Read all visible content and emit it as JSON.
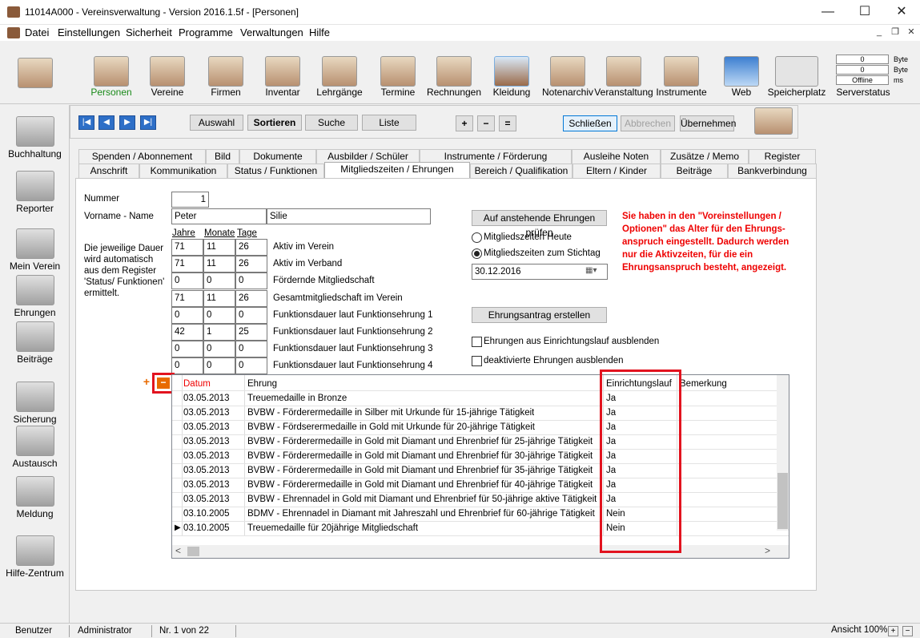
{
  "window": {
    "title": "11014A000 - Vereinsverwaltung - Version 2016.1.5f - [Personen]"
  },
  "menu": [
    "Datei",
    "Einstellungen",
    "Sicherheit",
    "Programme",
    "Verwaltungen",
    "Hilfe"
  ],
  "toolbar": {
    "items": [
      "Personen",
      "Vereine",
      "Firmen",
      "Inventar",
      "Lehrgänge",
      "Termine",
      "Rechnungen",
      "Kleidung",
      "Notenarchiv",
      "Veranstaltung",
      "Instrumente",
      "Web",
      "Speicherplatz"
    ],
    "server": {
      "v1": "0",
      "u1": "Byte",
      "v2": "0",
      "u2": "Byte",
      "v3": "Offline",
      "u3": "ms",
      "label": "Serverstatus"
    }
  },
  "sidebar": [
    "Buchhaltung",
    "Reporter",
    "Mein Verein",
    "Ehrungen",
    "Beiträge",
    "Sicherung",
    "Austausch",
    "Meldung",
    "Hilfe-Zentrum"
  ],
  "nav": {
    "auswahl": "Auswahl",
    "sortieren": "Sortieren",
    "suche": "Suche",
    "liste": "Liste",
    "plus": "+",
    "minus": "−",
    "eq": "=",
    "schliessen": "Schließen",
    "abbrechen": "Abbrechen",
    "uebernehmen": "Übernehmen"
  },
  "tabs_row1": [
    "Spenden / Abonnement",
    "Bild",
    "Dokumente",
    "Ausbilder / Schüler",
    "Instrumente / Förderung",
    "Ausleihe Noten",
    "Zusätze / Memo",
    "Register"
  ],
  "tabs_row2": [
    "Anschrift",
    "Kommunikation",
    "Status / Funktionen",
    "Mitgliedszeiten / Ehrungen",
    "Bereich / Qualifikation",
    "Eltern / Kinder",
    "Beiträge",
    "Bankverbindung"
  ],
  "form": {
    "nummer_label": "Nummer",
    "nummer": "1",
    "name_label": "Vorname - Name",
    "vorname": "Peter",
    "nachname": "Silie",
    "info": "Die jeweilige Dauer wird automatisch aus dem Register 'Status/ Funktionen' ermittelt.",
    "col_jahre": "Jahre",
    "col_monate": "Monate",
    "col_tage": "Tage",
    "rows": [
      {
        "j": "71",
        "m": "11",
        "t": "26",
        "label": "Aktiv im Verein"
      },
      {
        "j": "71",
        "m": "11",
        "t": "26",
        "label": "Aktiv im Verband"
      },
      {
        "j": "0",
        "m": "0",
        "t": "0",
        "label": "Fördernde Mitgliedschaft"
      },
      {
        "j": "71",
        "m": "11",
        "t": "26",
        "label": "Gesamtmitgliedschaft im Verein"
      },
      {
        "j": "0",
        "m": "0",
        "t": "0",
        "label": "Funktionsdauer laut Funktionsehrung 1"
      },
      {
        "j": "42",
        "m": "1",
        "t": "25",
        "label": "Funktionsdauer laut Funktionsehrung 2"
      },
      {
        "j": "0",
        "m": "0",
        "t": "0",
        "label": "Funktionsdauer laut Funktionsehrung 3"
      },
      {
        "j": "0",
        "m": "0",
        "t": "0",
        "label": "Funktionsdauer laut Funktionsehrung 4"
      }
    ],
    "check_btn": "Auf anstehende Ehrungen prüfen",
    "radio1": "Mitgliedszeiten Heute",
    "radio2": "Mitgliedszeiten zum Stichtag",
    "stichtag": "30.12.2016",
    "antrag_btn": "Ehrungsantrag erstellen",
    "cb1": "Ehrungen aus Einrichtungslauf ausblenden",
    "cb2": "deaktivierte Ehrungen ausblenden",
    "hint": "Sie haben in den \"Voreinstellungen / Optionen\" das Alter für den Ehrungs-anspruch eingestellt. Dadurch werden nur die Aktivzeiten, für die ein Ehrungsanspruch besteht, angezeigt.",
    "add_icon": "+",
    "remove_icon": "−"
  },
  "grid": {
    "headers": [
      "Datum",
      "Ehrung",
      "Einrichtungslauf",
      "Bemerkung"
    ],
    "rows": [
      [
        "03.05.2013",
        "Treuemedaille in Bronze",
        "Ja"
      ],
      [
        "03.05.2013",
        "BVBW - Förderermedaille in Silber mit Urkunde für 15-jährige Tätigkeit",
        "Ja"
      ],
      [
        "03.05.2013",
        "BVBW - Fördserermedaille in Gold mit Urkunde für 20-jährige Tätigkeit",
        "Ja"
      ],
      [
        "03.05.2013",
        "BVBW - Förderermedaille in Gold mit Diamant und Ehrenbrief für 25-jährige Tätigkeit",
        "Ja"
      ],
      [
        "03.05.2013",
        "BVBW - Förderermedaille in Gold mit Diamant und Ehrenbrief für 30-jährige Tätigkeit",
        "Ja"
      ],
      [
        "03.05.2013",
        "BVBW - Förderermedaille in Gold mit Diamant und Ehrenbrief für 35-jährige Tätigkeit",
        "Ja"
      ],
      [
        "03.05.2013",
        "BVBW - Förderermedaille in Gold mit Diamant und Ehrenbrief für 40-jährige Tätigkeit",
        "Ja"
      ],
      [
        "03.05.2013",
        "BVBW - Ehrennadel in Gold mit Diamant und Ehrenbrief für 50-jährige aktive Tätigkeit",
        "Ja"
      ],
      [
        "03.10.2005",
        "BDMV - Ehrennadel in Diamant mit Jahreszahl und Ehrenbrief für 60-jährige Tätigkeit",
        "Nein"
      ],
      [
        "03.10.2005",
        "Treuemedaille für 20jährige Mitgliedschaft",
        "Nein"
      ]
    ]
  },
  "status": {
    "user_label": "Benutzer",
    "user": "Administrator",
    "record": "Nr. 1 von 22",
    "zoom": "Ansicht 100%"
  },
  "colors": {
    "accent": "#e00000",
    "highlight": "#e2131f"
  }
}
